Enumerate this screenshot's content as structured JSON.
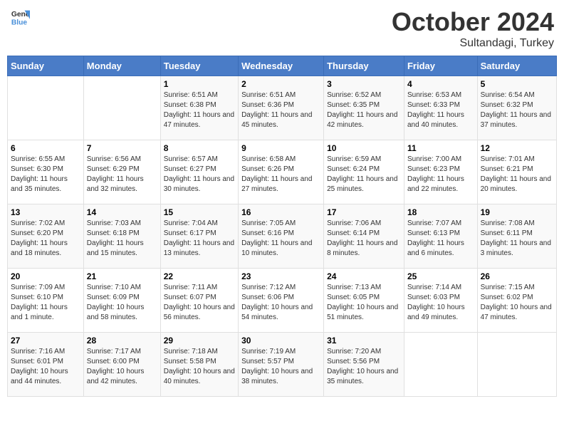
{
  "header": {
    "logo_general": "General",
    "logo_blue": "Blue",
    "title": "October 2024",
    "location": "Sultandagi, Turkey"
  },
  "days_of_week": [
    "Sunday",
    "Monday",
    "Tuesday",
    "Wednesday",
    "Thursday",
    "Friday",
    "Saturday"
  ],
  "weeks": [
    [
      {
        "num": "",
        "sunrise": "",
        "sunset": "",
        "daylight": ""
      },
      {
        "num": "",
        "sunrise": "",
        "sunset": "",
        "daylight": ""
      },
      {
        "num": "1",
        "sunrise": "Sunrise: 6:51 AM",
        "sunset": "Sunset: 6:38 PM",
        "daylight": "Daylight: 11 hours and 47 minutes."
      },
      {
        "num": "2",
        "sunrise": "Sunrise: 6:51 AM",
        "sunset": "Sunset: 6:36 PM",
        "daylight": "Daylight: 11 hours and 45 minutes."
      },
      {
        "num": "3",
        "sunrise": "Sunrise: 6:52 AM",
        "sunset": "Sunset: 6:35 PM",
        "daylight": "Daylight: 11 hours and 42 minutes."
      },
      {
        "num": "4",
        "sunrise": "Sunrise: 6:53 AM",
        "sunset": "Sunset: 6:33 PM",
        "daylight": "Daylight: 11 hours and 40 minutes."
      },
      {
        "num": "5",
        "sunrise": "Sunrise: 6:54 AM",
        "sunset": "Sunset: 6:32 PM",
        "daylight": "Daylight: 11 hours and 37 minutes."
      }
    ],
    [
      {
        "num": "6",
        "sunrise": "Sunrise: 6:55 AM",
        "sunset": "Sunset: 6:30 PM",
        "daylight": "Daylight: 11 hours and 35 minutes."
      },
      {
        "num": "7",
        "sunrise": "Sunrise: 6:56 AM",
        "sunset": "Sunset: 6:29 PM",
        "daylight": "Daylight: 11 hours and 32 minutes."
      },
      {
        "num": "8",
        "sunrise": "Sunrise: 6:57 AM",
        "sunset": "Sunset: 6:27 PM",
        "daylight": "Daylight: 11 hours and 30 minutes."
      },
      {
        "num": "9",
        "sunrise": "Sunrise: 6:58 AM",
        "sunset": "Sunset: 6:26 PM",
        "daylight": "Daylight: 11 hours and 27 minutes."
      },
      {
        "num": "10",
        "sunrise": "Sunrise: 6:59 AM",
        "sunset": "Sunset: 6:24 PM",
        "daylight": "Daylight: 11 hours and 25 minutes."
      },
      {
        "num": "11",
        "sunrise": "Sunrise: 7:00 AM",
        "sunset": "Sunset: 6:23 PM",
        "daylight": "Daylight: 11 hours and 22 minutes."
      },
      {
        "num": "12",
        "sunrise": "Sunrise: 7:01 AM",
        "sunset": "Sunset: 6:21 PM",
        "daylight": "Daylight: 11 hours and 20 minutes."
      }
    ],
    [
      {
        "num": "13",
        "sunrise": "Sunrise: 7:02 AM",
        "sunset": "Sunset: 6:20 PM",
        "daylight": "Daylight: 11 hours and 18 minutes."
      },
      {
        "num": "14",
        "sunrise": "Sunrise: 7:03 AM",
        "sunset": "Sunset: 6:18 PM",
        "daylight": "Daylight: 11 hours and 15 minutes."
      },
      {
        "num": "15",
        "sunrise": "Sunrise: 7:04 AM",
        "sunset": "Sunset: 6:17 PM",
        "daylight": "Daylight: 11 hours and 13 minutes."
      },
      {
        "num": "16",
        "sunrise": "Sunrise: 7:05 AM",
        "sunset": "Sunset: 6:16 PM",
        "daylight": "Daylight: 11 hours and 10 minutes."
      },
      {
        "num": "17",
        "sunrise": "Sunrise: 7:06 AM",
        "sunset": "Sunset: 6:14 PM",
        "daylight": "Daylight: 11 hours and 8 minutes."
      },
      {
        "num": "18",
        "sunrise": "Sunrise: 7:07 AM",
        "sunset": "Sunset: 6:13 PM",
        "daylight": "Daylight: 11 hours and 6 minutes."
      },
      {
        "num": "19",
        "sunrise": "Sunrise: 7:08 AM",
        "sunset": "Sunset: 6:11 PM",
        "daylight": "Daylight: 11 hours and 3 minutes."
      }
    ],
    [
      {
        "num": "20",
        "sunrise": "Sunrise: 7:09 AM",
        "sunset": "Sunset: 6:10 PM",
        "daylight": "Daylight: 11 hours and 1 minute."
      },
      {
        "num": "21",
        "sunrise": "Sunrise: 7:10 AM",
        "sunset": "Sunset: 6:09 PM",
        "daylight": "Daylight: 10 hours and 58 minutes."
      },
      {
        "num": "22",
        "sunrise": "Sunrise: 7:11 AM",
        "sunset": "Sunset: 6:07 PM",
        "daylight": "Daylight: 10 hours and 56 minutes."
      },
      {
        "num": "23",
        "sunrise": "Sunrise: 7:12 AM",
        "sunset": "Sunset: 6:06 PM",
        "daylight": "Daylight: 10 hours and 54 minutes."
      },
      {
        "num": "24",
        "sunrise": "Sunrise: 7:13 AM",
        "sunset": "Sunset: 6:05 PM",
        "daylight": "Daylight: 10 hours and 51 minutes."
      },
      {
        "num": "25",
        "sunrise": "Sunrise: 7:14 AM",
        "sunset": "Sunset: 6:03 PM",
        "daylight": "Daylight: 10 hours and 49 minutes."
      },
      {
        "num": "26",
        "sunrise": "Sunrise: 7:15 AM",
        "sunset": "Sunset: 6:02 PM",
        "daylight": "Daylight: 10 hours and 47 minutes."
      }
    ],
    [
      {
        "num": "27",
        "sunrise": "Sunrise: 7:16 AM",
        "sunset": "Sunset: 6:01 PM",
        "daylight": "Daylight: 10 hours and 44 minutes."
      },
      {
        "num": "28",
        "sunrise": "Sunrise: 7:17 AM",
        "sunset": "Sunset: 6:00 PM",
        "daylight": "Daylight: 10 hours and 42 minutes."
      },
      {
        "num": "29",
        "sunrise": "Sunrise: 7:18 AM",
        "sunset": "Sunset: 5:58 PM",
        "daylight": "Daylight: 10 hours and 40 minutes."
      },
      {
        "num": "30",
        "sunrise": "Sunrise: 7:19 AM",
        "sunset": "Sunset: 5:57 PM",
        "daylight": "Daylight: 10 hours and 38 minutes."
      },
      {
        "num": "31",
        "sunrise": "Sunrise: 7:20 AM",
        "sunset": "Sunset: 5:56 PM",
        "daylight": "Daylight: 10 hours and 35 minutes."
      },
      {
        "num": "",
        "sunrise": "",
        "sunset": "",
        "daylight": ""
      },
      {
        "num": "",
        "sunrise": "",
        "sunset": "",
        "daylight": ""
      }
    ]
  ]
}
